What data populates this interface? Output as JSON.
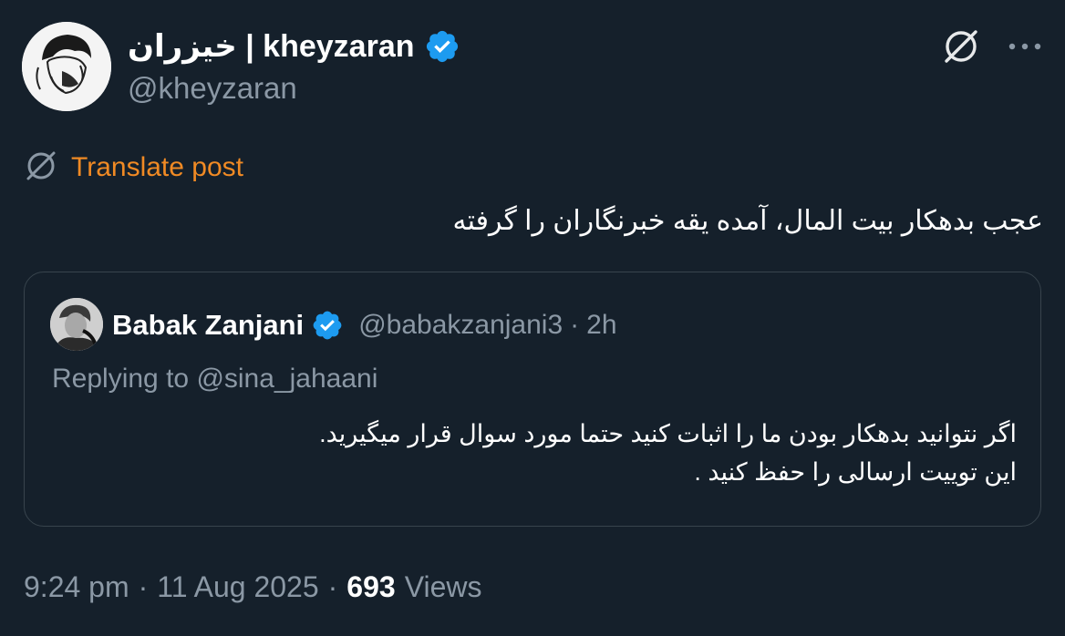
{
  "author": {
    "display_name": "خیزران | kheyzaran",
    "handle": "@kheyzaran",
    "avatar_icon": "avatar-illustration",
    "verified_icon": "verified-badge-icon"
  },
  "toolbar": {
    "grok_icon": "grok-icon",
    "more_icon": "more-icon",
    "more_label": "···"
  },
  "translate": {
    "label": "Translate post",
    "icon": "grok-icon",
    "color": "#f08a24"
  },
  "post": {
    "text": "عجب بدهکار بیت المال، آمده یقه خبرنگاران را گرفته"
  },
  "quote": {
    "name": "Babak Zanjani",
    "handle": "@babakzanjani3",
    "separator": "·",
    "time": "2h",
    "replying_prefix": "Replying to",
    "replying_to": "@sina_jahaani",
    "text_line1": "اگر نتوانید بدهکار بودن ما را اثبات کنید حتما مورد سوال قرار میگیرید.",
    "text_line2": "این توییت ارسالی را حفظ کنید ."
  },
  "meta": {
    "time": "9:24 pm",
    "separator": "·",
    "date": "11 Aug 2025",
    "views_count": "693",
    "views_label": "Views"
  },
  "colors": {
    "background": "#15202b",
    "secondary_text": "#8b98a5",
    "verified_blue": "#1d9bf0",
    "border": "#38444d"
  }
}
